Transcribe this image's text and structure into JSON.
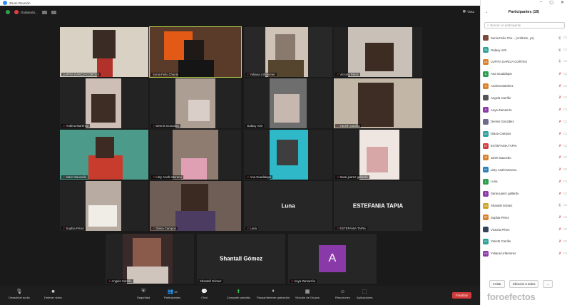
{
  "window": {
    "title": "Zoom Reunión"
  },
  "topbar": {
    "recording_label": "Grabando...",
    "view_label": "Vista"
  },
  "tiles": [
    {
      "name": "LUPITA GARCIA CORTES",
      "muted": false
    },
    {
      "name": "Sonia Felix Chante",
      "muted": false
    },
    {
      "name": "Yuliana Urtlemmer",
      "muted": true
    },
    {
      "name": "Victoria Pérez",
      "muted": true
    },
    {
      "name": "Andrea Martínez",
      "muted": true
    },
    {
      "name": "Dennis Gonzalez",
      "muted": true
    },
    {
      "name": "Galaxy A20",
      "muted": false
    },
    {
      "name": "Yaneth Carrillo",
      "muted": true
    },
    {
      "name": "Janet Saucedo",
      "muted": true
    },
    {
      "name": "Litzy Anahi Moreno",
      "muted": true
    },
    {
      "name": "Ana Guadalupe",
      "muted": true
    },
    {
      "name": "Sarai juarez gallardo",
      "muted": true
    },
    {
      "name": "Sophia Pérez",
      "muted": true
    },
    {
      "name": "Diana Campos",
      "muted": true
    },
    {
      "name": "Luna",
      "muted": true,
      "big": "Luna"
    },
    {
      "name": "ESTEFANIA TAPIA",
      "muted": true,
      "big": "ESTEFANIA TAPIA"
    },
    {
      "name": "Angela Carrillo",
      "muted": true
    },
    {
      "name": "Shantall Gómez",
      "muted": false,
      "big": "Shantall Gómez"
    },
    {
      "name": "Anya Zamarrón",
      "muted": true,
      "avatar": "A"
    }
  ],
  "toolbar": {
    "items": [
      {
        "label": "Desactivar audio",
        "icon": "microphone-icon"
      },
      {
        "label": "Detener video",
        "icon": "video-camera-icon"
      },
      {
        "label": "Seguridad",
        "icon": "shield-icon"
      },
      {
        "label": "Participantes",
        "icon": "participants-icon",
        "count": "19"
      },
      {
        "label": "Chat",
        "icon": "chat-icon"
      },
      {
        "label": "Compartir pantalla",
        "icon": "share-screen-icon"
      },
      {
        "label": "Pausar/detener grabación",
        "icon": "pause-record-icon"
      },
      {
        "label": "Sección de Grupos",
        "icon": "breakout-rooms-icon"
      },
      {
        "label": "Reacciones",
        "icon": "reactions-icon"
      },
      {
        "label": "Aplicaciones",
        "icon": "apps-icon"
      }
    ],
    "end_label": "Finalizar"
  },
  "panel": {
    "title": "Participantes (19)",
    "search_placeholder": "Buscar un participante",
    "participants": [
      {
        "initials": "",
        "name": "Sonia Felix Che... (Anfitrión, yo)",
        "color": "#7a4a3a",
        "muted": false
      },
      {
        "initials": "GA",
        "name": "Galaxy A20",
        "color": "#2aa198",
        "muted": false
      },
      {
        "initials": "LG",
        "name": "LUPITA GARCIA CORTES",
        "color": "#d9822b",
        "muted": false
      },
      {
        "initials": "A",
        "name": "Ana Guadalupe",
        "color": "#2e9e4f",
        "muted": true
      },
      {
        "initials": "A",
        "name": "Andrea Martínez",
        "color": "#d9822b",
        "muted": true
      },
      {
        "initials": "",
        "name": "Angela Carrillo",
        "color": "#555555",
        "muted": true
      },
      {
        "initials": "A",
        "name": "Anya Zamarrón",
        "color": "#8a3aa8",
        "muted": true
      },
      {
        "initials": "",
        "name": "Dennis González",
        "color": "#6b6b8a",
        "muted": true
      },
      {
        "initials": "DC",
        "name": "Diana Campos",
        "color": "#2aa198",
        "muted": true
      },
      {
        "initials": "ET",
        "name": "ESTEFANIA TAPIA",
        "color": "#d23b3b",
        "muted": true
      },
      {
        "initials": "JS",
        "name": "Janet Saucedo",
        "color": "#d9822b",
        "muted": true
      },
      {
        "initials": "LA",
        "name": "Litzy Anahi Moreno",
        "color": "#2a7fb8",
        "muted": true
      },
      {
        "initials": "L",
        "name": "Luna",
        "color": "#2e9e4f",
        "muted": true
      },
      {
        "initials": "S",
        "name": "Sarai juarez gallardo",
        "color": "#8a3aa8",
        "muted": true
      },
      {
        "initials": "SG",
        "name": "Shantall Gómez",
        "color": "#c9a227",
        "muted": false
      },
      {
        "initials": "SP",
        "name": "Sophia Pérez",
        "color": "#d9822b",
        "muted": true
      },
      {
        "initials": "",
        "name": "Victoria Pérez",
        "color": "#33445a",
        "muted": true
      },
      {
        "initials": "YC",
        "name": "Yaneth Carrillo",
        "color": "#2aa198",
        "muted": true
      },
      {
        "initials": "YU",
        "name": "Yuliana Urtlemmer",
        "color": "#8a3aa8",
        "muted": true
      }
    ],
    "invite_label": "Invitar",
    "mute_all_label": "Silenciar a todos",
    "more_label": "..."
  },
  "watermark": "foroefectos"
}
